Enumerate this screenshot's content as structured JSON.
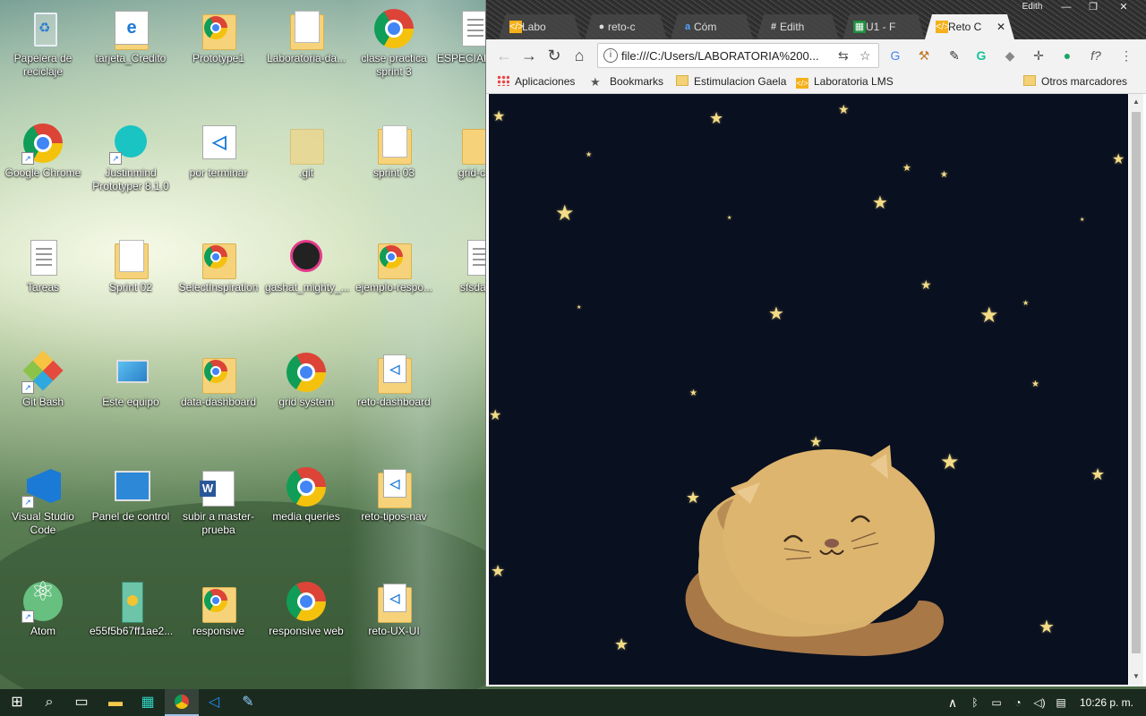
{
  "desktop": {
    "icons": [
      {
        "label": "Papelera de reciclaje",
        "icon": "recycle-bin-icon"
      },
      {
        "label": "tarjeta_Credito",
        "icon": "folder-icon"
      },
      {
        "label": "Prototype1",
        "icon": "folder-chrome-icon"
      },
      {
        "label": "Laboratoria-da...",
        "icon": "folder-icon"
      },
      {
        "label": "clase practica sprint 3",
        "icon": "chrome-icon"
      },
      {
        "label": "ESPECIAL",
        "icon": "document-icon"
      },
      {
        "label": "Google Chrome",
        "icon": "chrome-icon"
      },
      {
        "label": "Justinmind Prototyper 8.1.0",
        "icon": "justinmind-icon"
      },
      {
        "label": "por terminar",
        "icon": "vscode-file-icon"
      },
      {
        "label": ".git",
        "icon": "folder-icon"
      },
      {
        "label": "sprint 03",
        "icon": "folder-icon"
      },
      {
        "label": "grid-c",
        "icon": "folder-icon"
      },
      {
        "label": "Tareas",
        "icon": "document-icon"
      },
      {
        "label": "Sprint 02",
        "icon": "folder-icon"
      },
      {
        "label": "SelectInspiration",
        "icon": "folder-chrome-icon"
      },
      {
        "label": "gashat_mighty_...",
        "icon": "image-icon"
      },
      {
        "label": "ejemplo-respo...",
        "icon": "folder-chrome-icon"
      },
      {
        "label": "sfsda",
        "icon": "document-icon"
      },
      {
        "label": "Git Bash",
        "icon": "git-bash-icon"
      },
      {
        "label": "Este equipo",
        "icon": "computer-icon"
      },
      {
        "label": "data-dashboard",
        "icon": "folder-chrome-icon"
      },
      {
        "label": "grid system",
        "icon": "chrome-icon"
      },
      {
        "label": "reto-dashboard",
        "icon": "folder-vscode-icon"
      },
      {
        "label": "Visual Studio Code",
        "icon": "vscode-icon"
      },
      {
        "label": "Panel de control",
        "icon": "control-panel-icon"
      },
      {
        "label": "subir a master-prueba",
        "icon": "word-icon"
      },
      {
        "label": "media queries",
        "icon": "chrome-icon"
      },
      {
        "label": "reto-tipos-nav",
        "icon": "folder-vscode-icon"
      },
      {
        "label": "Atom",
        "icon": "atom-icon"
      },
      {
        "label": "e55f5b67ff1ae2...",
        "icon": "image-icon"
      },
      {
        "label": "responsive",
        "icon": "folder-chrome-icon"
      },
      {
        "label": "responsive web",
        "icon": "chrome-icon"
      },
      {
        "label": "reto-UX-UI",
        "icon": "folder-vscode-icon"
      }
    ]
  },
  "browser": {
    "user_name": "Edith",
    "tabs": [
      {
        "label": "Labo",
        "icon": "lms-icon"
      },
      {
        "label": "reto-c",
        "icon": "github-icon"
      },
      {
        "label": "Cóm",
        "icon": "a-icon"
      },
      {
        "label": "Edith",
        "icon": "slack-icon"
      },
      {
        "label": "U1 - F",
        "icon": "sheets-icon"
      },
      {
        "label": "Reto C",
        "icon": "lms-icon"
      }
    ],
    "address": "file:///C:/Users/LABORATORIA%200...",
    "bookmarks": [
      {
        "label": "Aplicaciones",
        "icon": "apps-icon"
      },
      {
        "label": "Bookmarks",
        "icon": "star-icon"
      },
      {
        "label": "Estimulacion Gaela",
        "icon": "folder-icon"
      },
      {
        "label": "Laboratoria LMS",
        "icon": "lms-icon"
      },
      {
        "label": "Otros marcadores",
        "icon": "folder-icon"
      }
    ],
    "page": {
      "background": "#091020",
      "star_color": "#f4dc86",
      "cat_color": "#d9b36d",
      "tail_color": "#a97847"
    }
  },
  "taskbar": {
    "clock": "10:26 p. m.",
    "apps": [
      "start-icon",
      "search-icon",
      "task-view-icon",
      "file-explorer-icon",
      "calculator-icon",
      "chrome-icon",
      "vscode-icon",
      "paint-icon"
    ]
  }
}
